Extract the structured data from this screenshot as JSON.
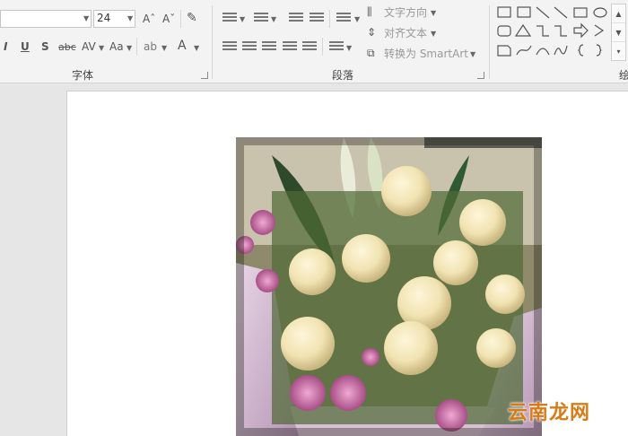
{
  "ribbon": {
    "font_group": {
      "label": "字体",
      "font_size": "24",
      "grow_font_icon": "Aˆ",
      "shrink_font_icon": "Aˇ",
      "italic": "I",
      "underline": "U",
      "shadow": "S",
      "strikethrough": "abc",
      "char_spacing": "AV",
      "change_case": "Aa",
      "font_color": "A"
    },
    "paragraph_group": {
      "label": "段落",
      "text_direction": "文字方向",
      "align_text": "对齐文本",
      "convert_smartart": "转换为 SmartArt"
    },
    "drawing_group": {
      "label_partial": "绘"
    }
  },
  "watermark": "云南龙网",
  "colors": {
    "ribbon_bg": "#f3f3f3",
    "slide_bg": "#ffffff",
    "workspace_bg": "#e6e6e6",
    "watermark": "#d97b17"
  }
}
